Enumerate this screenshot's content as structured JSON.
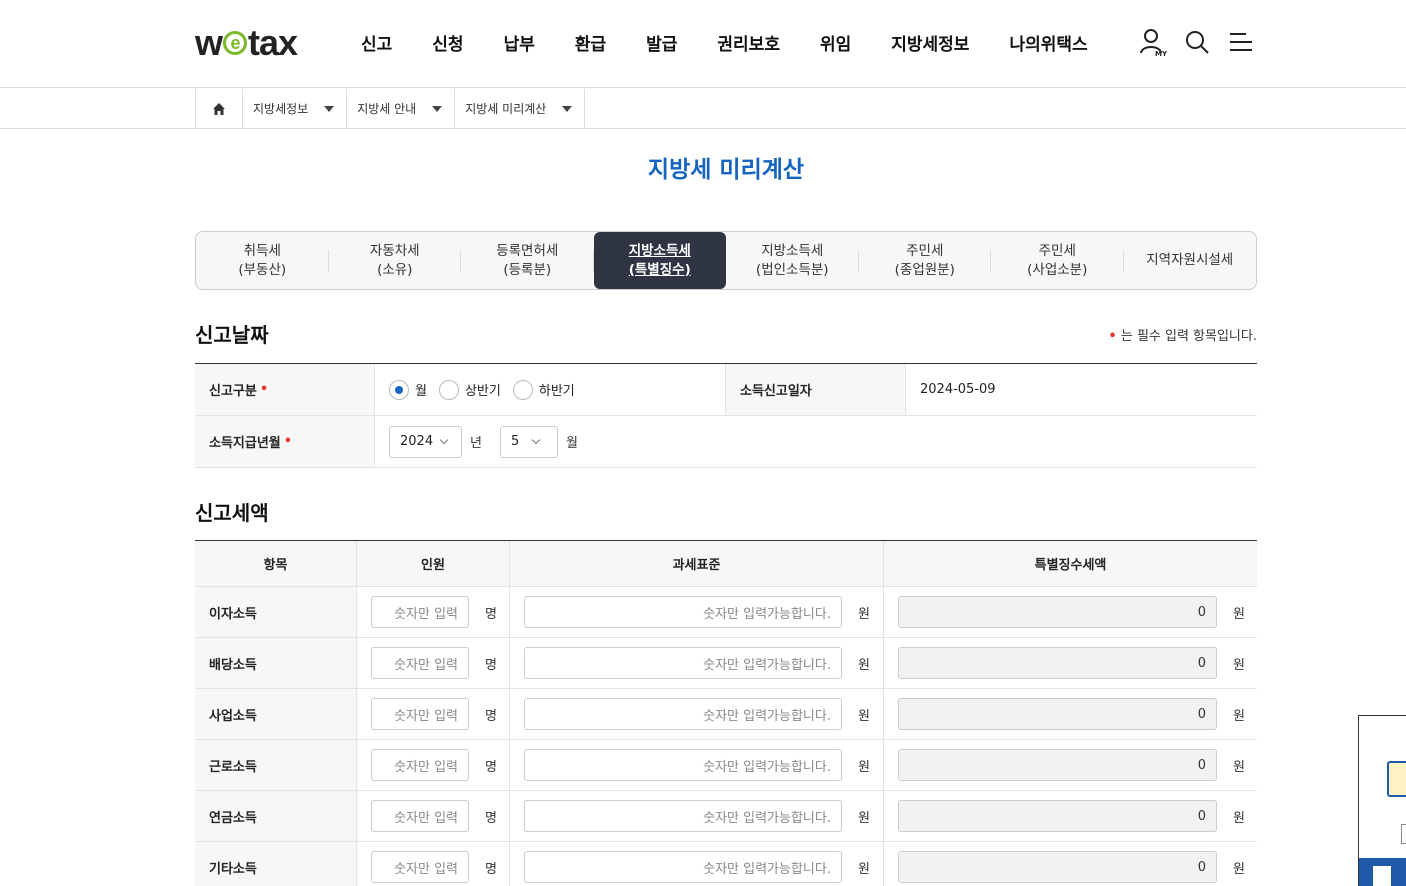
{
  "header": {
    "logo": {
      "pre": "w",
      "e": "e",
      "post": "tax"
    },
    "nav": [
      "신고",
      "신청",
      "납부",
      "환급",
      "발급",
      "권리보호",
      "위임",
      "지방세정보",
      "나의위택스"
    ],
    "icons": [
      "my-user-icon",
      "search-icon",
      "menu-icon"
    ]
  },
  "breadcrumb": [
    "지방세정보",
    "지방세 안내",
    "지방세 미리계산"
  ],
  "page_title": "지방세 미리계산",
  "tabs": [
    {
      "label": "취득세\n(부동산)"
    },
    {
      "label": "자동차세\n(소유)"
    },
    {
      "label": "등록면허세\n(등록분)"
    },
    {
      "label": "지방소득세\n(특별징수)",
      "active": true
    },
    {
      "label": "지방소득세\n(법인소득분)"
    },
    {
      "label": "주민세\n(종업원분)"
    },
    {
      "label": "주민세\n(사업소분)"
    },
    {
      "label": "지역자원시설세"
    }
  ],
  "section1": {
    "title": "신고날짜",
    "required_note": "는 필수 입력 항목입니다.",
    "required_mark": "•",
    "report_type": {
      "label": "신고구분",
      "options": [
        "월",
        "상반기",
        "하반기"
      ],
      "selected": "월"
    },
    "income_report_date": {
      "label": "소득신고일자",
      "value": "2024-05-09"
    },
    "payment_month": {
      "label": "소득지급년월",
      "year": "2024",
      "year_unit": "년",
      "month": "5",
      "month_unit": "월"
    }
  },
  "section2": {
    "title": "신고세액",
    "columns": [
      "항목",
      "인원",
      "과세표준",
      "특별징수세액"
    ],
    "count_placeholder": "숫자만 입력",
    "count_unit": "명",
    "base_placeholder": "숫자만 입력가능합니다.",
    "won_unit": "원",
    "rows": [
      {
        "item": "이자소득",
        "tax": "0"
      },
      {
        "item": "배당소득",
        "tax": "0"
      },
      {
        "item": "사업소득",
        "tax": "0"
      },
      {
        "item": "근로소득",
        "tax": "0"
      },
      {
        "item": "연금소득",
        "tax": "0"
      },
      {
        "item": "기타소득",
        "tax": "0"
      }
    ]
  },
  "colors": {
    "accent": "#1565c0",
    "active_tab": "#2f3443",
    "logo_green": "#7ab929",
    "required": "#e53935"
  }
}
